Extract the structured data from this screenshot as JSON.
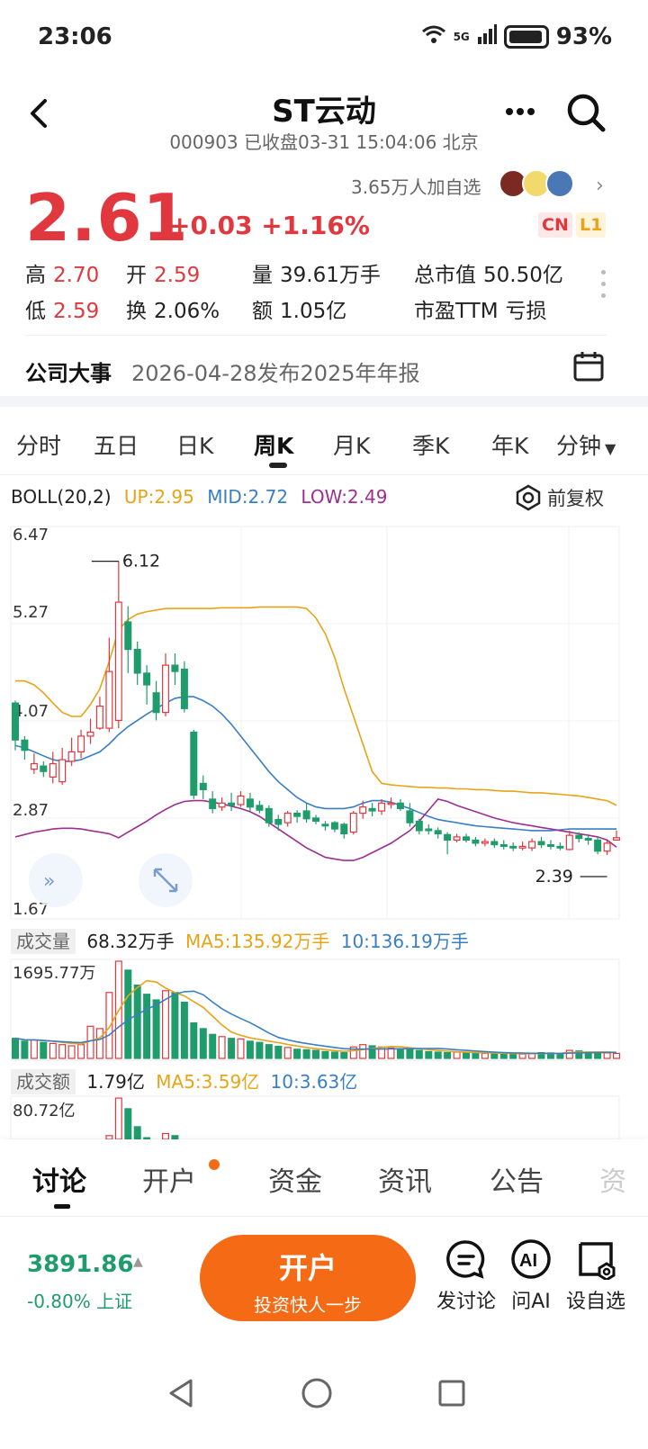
{
  "status_bar": {
    "time": "23:06",
    "network": "5G",
    "battery": "93%"
  },
  "header": {
    "title": "ST云动",
    "subtitle": "000903 已收盘03-31 15:04:06 北京"
  },
  "quote": {
    "price": "2.61",
    "change": "+0.03 +1.16%",
    "watchers": "3.65万人加自选",
    "tag_cn": "CN",
    "tag_l1": "L1",
    "rows": [
      [
        {
          "label": "高",
          "value": "2.70",
          "red": true
        },
        {
          "label": "开",
          "value": "2.59",
          "red": true
        },
        {
          "label": "量",
          "value": "39.61万手",
          "red": false
        },
        {
          "label": "总市值",
          "value": "50.50亿",
          "red": false
        }
      ],
      [
        {
          "label": "低",
          "value": "2.59",
          "red": true
        },
        {
          "label": "换",
          "value": "2.06%",
          "red": false
        },
        {
          "label": "额",
          "value": "1.05亿",
          "red": false
        },
        {
          "label": "市盈TTM",
          "value": "亏损",
          "red": false
        }
      ]
    ]
  },
  "event": {
    "label": "公司大事",
    "text": "2026-04-28发布2025年年报"
  },
  "period_tabs": [
    "分时",
    "五日",
    "日K",
    "周K",
    "月K",
    "季K",
    "年K",
    "分钟"
  ],
  "active_period": "周K",
  "boll": {
    "name": "BOLL(20,2)",
    "up": "UP:2.95",
    "mid": "MID:2.72",
    "low": "LOW:2.49",
    "adjust": "前复权"
  },
  "colors": {
    "up": "#e0383e",
    "down": "#1f9c6b",
    "boll_up": "#e8a317",
    "boll_mid": "#3a7fc4",
    "boll_low": "#9c2f8f",
    "accent": "#f56a14"
  },
  "chart_data": {
    "type": "candlestick",
    "y_ticks": [
      "6.47",
      "5.27",
      "4.07",
      "2.87",
      "1.67"
    ],
    "ylim": [
      1.67,
      6.47
    ],
    "max_label": "6.12",
    "min_label": "2.39",
    "candles": [
      [
        4.32,
        3.85,
        3.72,
        4.35
      ],
      [
        3.85,
        3.72,
        3.6,
        3.9
      ],
      [
        3.48,
        3.55,
        3.42,
        3.68
      ],
      [
        3.52,
        3.45,
        3.38,
        3.58
      ],
      [
        3.38,
        3.55,
        3.3,
        3.7
      ],
      [
        3.32,
        3.6,
        3.28,
        3.75
      ],
      [
        3.58,
        3.7,
        3.52,
        3.88
      ],
      [
        3.7,
        3.9,
        3.62,
        3.98
      ],
      [
        3.9,
        3.95,
        3.8,
        4.12
      ],
      [
        4.0,
        4.28,
        3.98,
        4.4
      ],
      [
        4.0,
        4.72,
        3.95,
        5.15
      ],
      [
        4.1,
        5.6,
        4.0,
        6.12
      ],
      [
        5.35,
        5.0,
        4.7,
        5.55
      ],
      [
        5.0,
        4.7,
        4.55,
        5.1
      ],
      [
        4.7,
        4.55,
        4.3,
        4.8
      ],
      [
        4.45,
        4.2,
        4.1,
        4.6
      ],
      [
        4.2,
        4.8,
        4.15,
        4.95
      ],
      [
        4.8,
        4.72,
        4.55,
        4.95
      ],
      [
        4.75,
        4.25,
        4.2,
        4.85
      ],
      [
        3.95,
        3.15,
        3.1,
        3.98
      ],
      [
        3.3,
        3.22,
        3.1,
        3.4
      ],
      [
        3.1,
        2.98,
        2.92,
        3.2
      ],
      [
        3.0,
        3.05,
        2.95,
        3.12
      ],
      [
        3.05,
        3.02,
        2.95,
        3.18
      ],
      [
        3.03,
        3.14,
        3.0,
        3.2
      ],
      [
        3.1,
        3.0,
        2.95,
        3.18
      ],
      [
        3.02,
        2.96,
        2.92,
        3.08
      ],
      [
        2.98,
        2.8,
        2.75,
        3.02
      ],
      [
        2.84,
        2.78,
        2.7,
        2.9
      ],
      [
        2.8,
        2.92,
        2.75,
        2.95
      ],
      [
        2.92,
        2.88,
        2.8,
        2.96
      ],
      [
        2.95,
        2.85,
        2.8,
        3.05
      ],
      [
        2.86,
        2.82,
        2.78,
        2.9
      ],
      [
        2.78,
        2.76,
        2.7,
        2.82
      ],
      [
        2.8,
        2.72,
        2.68,
        2.82
      ],
      [
        2.78,
        2.66,
        2.6,
        2.8
      ],
      [
        2.68,
        2.92,
        2.65,
        2.95
      ],
      [
        2.92,
        3.0,
        2.85,
        3.08
      ],
      [
        2.98,
        2.95,
        2.88,
        3.05
      ],
      [
        2.95,
        3.05,
        2.9,
        3.1
      ],
      [
        3.05,
        3.05,
        2.98,
        3.12
      ],
      [
        3.05,
        2.98,
        2.95,
        3.1
      ],
      [
        2.95,
        2.8,
        2.75,
        3.05
      ],
      [
        2.82,
        2.7,
        2.65,
        2.85
      ],
      [
        2.72,
        2.7,
        2.65,
        2.78
      ],
      [
        2.7,
        2.66,
        2.6,
        2.74
      ],
      [
        2.65,
        2.58,
        2.4,
        2.68
      ],
      [
        2.58,
        2.62,
        2.55,
        2.66
      ],
      [
        2.62,
        2.58,
        2.55,
        2.66
      ],
      [
        2.58,
        2.54,
        2.5,
        2.62
      ],
      [
        2.54,
        2.56,
        2.5,
        2.6
      ],
      [
        2.56,
        2.52,
        2.48,
        2.6
      ],
      [
        2.52,
        2.5,
        2.46,
        2.58
      ],
      [
        2.5,
        2.48,
        2.44,
        2.55
      ],
      [
        2.48,
        2.5,
        2.45,
        2.56
      ],
      [
        2.48,
        2.56,
        2.44,
        2.6
      ],
      [
        2.56,
        2.52,
        2.48,
        2.62
      ],
      [
        2.52,
        2.5,
        2.46,
        2.58
      ],
      [
        2.5,
        2.48,
        2.45,
        2.55
      ],
      [
        2.46,
        2.64,
        2.45,
        2.7
      ],
      [
        2.64,
        2.6,
        2.55,
        2.68
      ],
      [
        2.6,
        2.58,
        2.52,
        2.64
      ],
      [
        2.58,
        2.44,
        2.4,
        2.62
      ],
      [
        2.44,
        2.54,
        2.39,
        2.58
      ],
      [
        2.58,
        2.61,
        2.59,
        2.7
      ]
    ],
    "boll_up": [
      4.6,
      4.6,
      4.55,
      4.45,
      4.32,
      4.2,
      4.15,
      4.15,
      4.3,
      4.5,
      4.85,
      5.25,
      5.38,
      5.45,
      5.48,
      5.5,
      5.52,
      5.52,
      5.52,
      5.52,
      5.52,
      5.52,
      5.53,
      5.53,
      5.53,
      5.53,
      5.54,
      5.54,
      5.54,
      5.54,
      5.54,
      5.52,
      5.4,
      5.2,
      4.9,
      4.5,
      4.15,
      3.8,
      3.45,
      3.3,
      3.28,
      3.27,
      3.26,
      3.25,
      3.25,
      3.24,
      3.24,
      3.23,
      3.23,
      3.22,
      3.22,
      3.21,
      3.2,
      3.2,
      3.19,
      3.18,
      3.18,
      3.17,
      3.16,
      3.15,
      3.14,
      3.12,
      3.1,
      3.08,
      3.02
    ],
    "boll_mid": [
      3.78,
      3.75,
      3.7,
      3.65,
      3.6,
      3.58,
      3.58,
      3.6,
      3.65,
      3.7,
      3.8,
      3.92,
      4.02,
      4.1,
      4.18,
      4.25,
      4.32,
      4.38,
      4.4,
      4.4,
      4.35,
      4.28,
      4.18,
      4.05,
      3.9,
      3.75,
      3.6,
      3.45,
      3.32,
      3.22,
      3.12,
      3.05,
      3.0,
      2.98,
      2.98,
      2.98,
      3.0,
      3.05,
      3.08,
      3.08,
      3.06,
      3.02,
      2.98,
      2.93,
      2.88,
      2.84,
      2.82,
      2.8,
      2.78,
      2.76,
      2.75,
      2.74,
      2.73,
      2.72,
      2.71,
      2.7,
      2.7,
      2.7,
      2.71,
      2.72,
      2.72,
      2.72,
      2.72,
      2.72,
      2.72
    ],
    "boll_low": [
      2.62,
      2.65,
      2.68,
      2.7,
      2.72,
      2.73,
      2.73,
      2.72,
      2.7,
      2.68,
      2.66,
      2.61,
      2.68,
      2.75,
      2.82,
      2.9,
      2.97,
      3.03,
      3.07,
      3.08,
      3.08,
      3.06,
      3.04,
      3.01,
      2.98,
      2.94,
      2.88,
      2.8,
      2.72,
      2.64,
      2.56,
      2.48,
      2.42,
      2.36,
      2.34,
      2.32,
      2.32,
      2.36,
      2.42,
      2.48,
      2.54,
      2.62,
      2.7,
      2.82,
      2.96,
      3.1,
      3.07,
      3.02,
      2.98,
      2.94,
      2.9,
      2.86,
      2.83,
      2.8,
      2.78,
      2.76,
      2.74,
      2.72,
      2.7,
      2.68,
      2.66,
      2.64,
      2.62,
      2.58,
      2.49
    ],
    "volume": {
      "header": "68.32万手",
      "ma5": "MA5:135.92万手",
      "ma10": "10:136.19万手",
      "top": "1695.77万",
      "max": 1695.77,
      "values": [
        350,
        300,
        320,
        280,
        260,
        240,
        220,
        240,
        560,
        520,
        1150,
        1695,
        1540,
        1280,
        1120,
        1020,
        1180,
        1150,
        980,
        620,
        520,
        420,
        380,
        350,
        340,
        300,
        280,
        240,
        210,
        190,
        160,
        150,
        140,
        120,
        110,
        100,
        200,
        240,
        220,
        200,
        180,
        170,
        160,
        140,
        120,
        110,
        100,
        110,
        100,
        90,
        90,
        85,
        80,
        80,
        75,
        90,
        100,
        95,
        85,
        140,
        130,
        110,
        100,
        95,
        88
      ]
    },
    "amount": {
      "header": "1.79亿",
      "ma5": "MA5:3.59亿",
      "ma10": "10:3.63亿",
      "top": "80.72亿"
    }
  },
  "bottom_tabs": [
    "讨论",
    "开户",
    "资金",
    "资讯",
    "公告",
    "资"
  ],
  "footer": {
    "index_value": "3891.86",
    "index_change": "-0.80% 上证",
    "open_main": "开户",
    "open_sub": "投资快人一步",
    "actions": [
      "发讨论",
      "问AI",
      "设自选"
    ]
  }
}
